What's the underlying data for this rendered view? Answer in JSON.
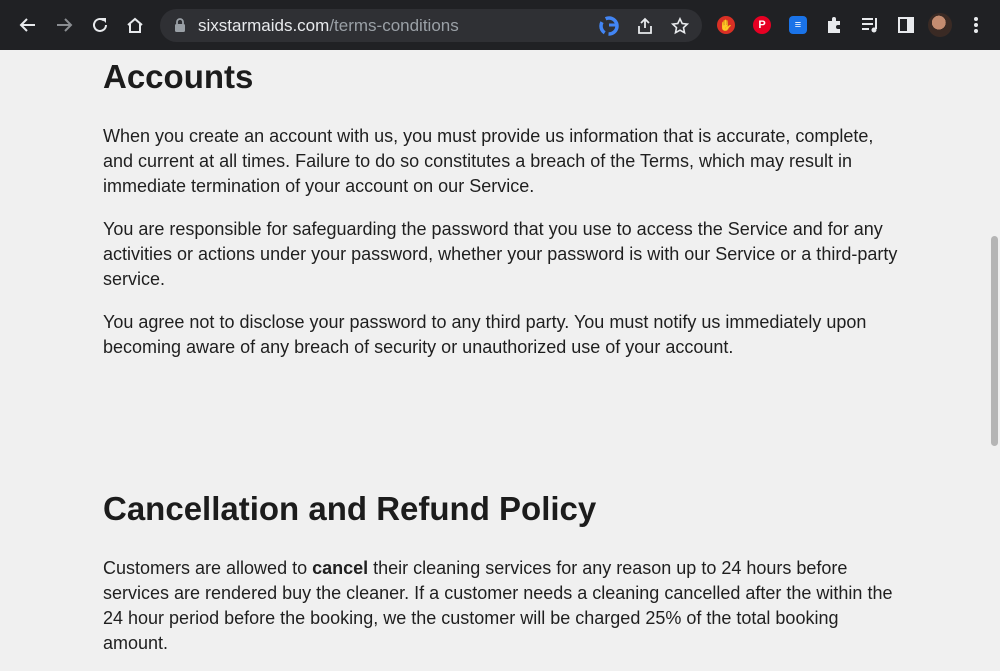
{
  "browser": {
    "url_domain": "sixstarmaids.com",
    "url_path": "/terms-conditions"
  },
  "icons": {
    "back": "back-arrow-icon",
    "forward": "forward-arrow-icon",
    "reload": "reload-icon",
    "home": "home-icon",
    "lock": "lock-icon",
    "google": "google-icon",
    "share": "share-icon",
    "bookmark": "star-icon",
    "extensions": [
      "stop-extension-icon",
      "pinterest-icon",
      "docs-extension-icon",
      "puzzle-icon",
      "media-queue-icon",
      "side-panel-icon"
    ],
    "menu": "kebab-menu-icon"
  },
  "sections": [
    {
      "heading": "Accounts",
      "paragraphs": [
        "When you create an account with us, you must provide us information that is accurate, complete, and current at all times. Failure to do so constitutes a breach of the Terms, which may result in immediate termination of your account on our Service.",
        "You are responsible for safeguarding the password that you use to access the Service and for any activities or actions under your password, whether your password is with our Service or a third-party service.",
        "You agree not to disclose your password to any third party. You must notify us immediately upon becoming aware of any breach of security or unauthorized use of your account."
      ]
    },
    {
      "heading": "Cancellation and Refund Policy",
      "paragraphs": [
        {
          "before": "Customers are allowed to ",
          "bold": "cancel",
          "after": " their cleaning services for any reason up to 24 hours before services are rendered buy the cleaner. If a customer needs a cleaning cancelled after the within the 24 hour period before the booking, we the customer will be charged 25% of the total booking amount."
        }
      ]
    }
  ],
  "colors": {
    "toolbar": "#202124",
    "omnibox": "#2f3034",
    "page_background": "#f0f0f0",
    "text": "#1f1f1f"
  }
}
